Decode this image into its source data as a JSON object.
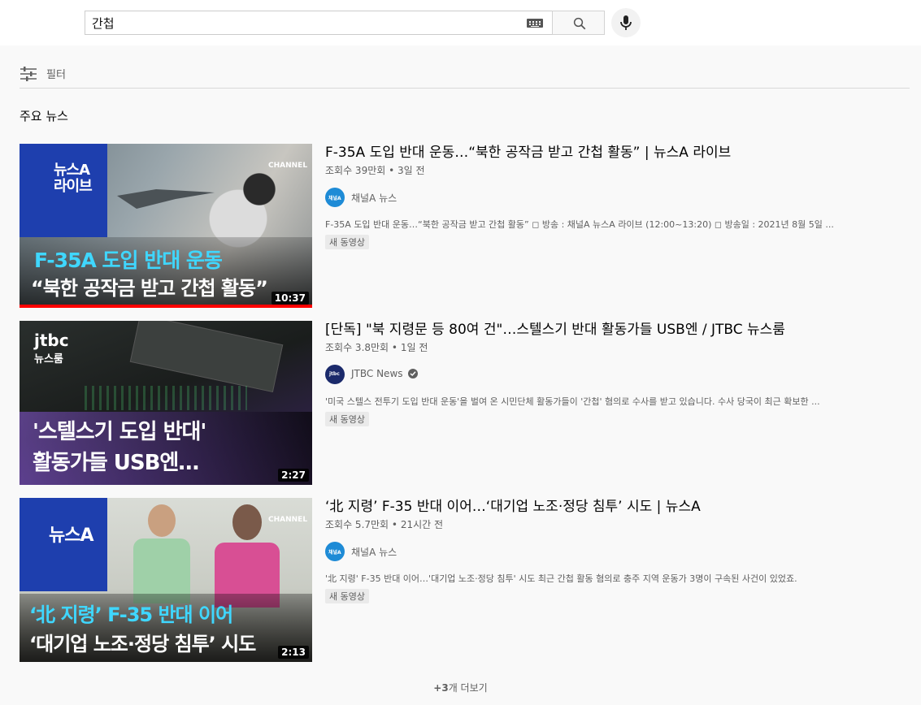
{
  "search": {
    "query": "간첩"
  },
  "filter": {
    "label": "필터"
  },
  "section": {
    "title": "주요 뉴스"
  },
  "videos": [
    {
      "title": "F-35A 도입 반대 운동…“북한 공작금 받고 간첩 활동” | 뉴스A 라이브",
      "views": "조회수 39만회",
      "age": "3일 전",
      "channel": "채널A 뉴스",
      "description": "F-35A 도입 반대 운동…“북한 공작금 받고 간첩 활동” ◻ 방송 : 채널A 뉴스A 라이브 (12:00~13:20) ◻ 방송일 : 2021년 8월 5일 ...",
      "badge": "새 동영상",
      "duration": "10:37",
      "thumb_logo": "뉴스A",
      "thumb_logo2": "라이브",
      "thumb_channel": "CHANNEL",
      "thumb_line1": "F-35A 도입 반대 운동",
      "thumb_line2": "“북한 공작금 받고 간첩 활동”"
    },
    {
      "title": "[단독] \"북 지령문 등 80여 건\"…스텔스기 반대 활동가들 USB엔 / JTBC 뉴스룸",
      "views": "조회수 3.8만회",
      "age": "1일 전",
      "channel": "JTBC News",
      "description": "'미국 스텔스 전투기 도입 반대 운동'을 벌여 온 시민단체 활동가들이 '간첩' 혐의로 수사를 받고 있습니다. 수사 당국이 최근 확보한 ...",
      "badge": "새 동영상",
      "duration": "2:27",
      "thumb_logo": "jtbc",
      "thumb_logo2": "뉴스룸",
      "thumb_line1": "'스텔스기 도입 반대'",
      "thumb_line2": "활동가들 USB엔…"
    },
    {
      "title": "‘北 지령’ F-35 반대 이어…‘대기업 노조·정당 침투’ 시도 | 뉴스A",
      "views": "조회수 5.7만회",
      "age": "21시간 전",
      "channel": "채널A 뉴스",
      "description": "'北 지령' F-35 반대 이어…'대기업 노조·정당 침투' 시도 최근 간첩 활동 혐의로 충주 지역 운동가 3명이 구속된 사건이 있었죠.",
      "badge": "새 동영상",
      "duration": "2:13",
      "thumb_logo": "뉴스A",
      "thumb_channel": "CHANNEL",
      "thumb_line1": "‘北 지령’ F-35 반대 이어",
      "thumb_line2": "‘대기업 노조·정당 침투’ 시도"
    }
  ],
  "more": {
    "count": "+3",
    "label": "개 더보기"
  },
  "colors": {
    "accent_red": "#ff0000",
    "thumb_blue": "#1e3fae",
    "thumb_cyan": "#3fd7ff"
  }
}
